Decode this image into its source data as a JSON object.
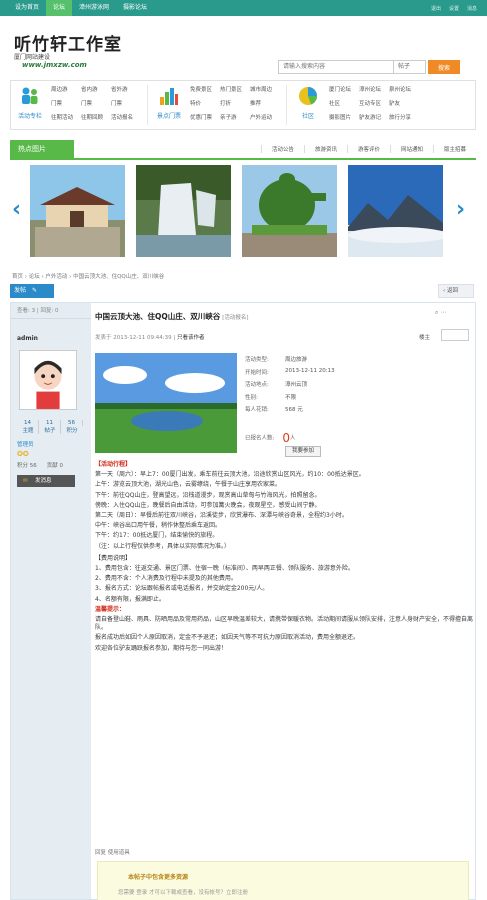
{
  "topbar": {
    "links": [
      "设为首页",
      "论坛",
      "漳州游泳网",
      "摄影论坛"
    ],
    "active_index": 1,
    "right": [
      "退出",
      "设置",
      "消息"
    ]
  },
  "header": {
    "logo_title": "听竹轩工作室",
    "logo_subtitle": "厦门网站建设",
    "logo_url": "www.jmxzw.com",
    "search_placeholder": "请输入搜索内容",
    "search_scope": "帖子",
    "search_button": "搜索"
  },
  "nav": {
    "groups": [
      {
        "icon": "people-icon",
        "label": "活动专栏",
        "color": "#2a9ad8",
        "links": [
          "周边游",
          "省内游",
          "省外游",
          "门票",
          "门票",
          "门票",
          "往期活动",
          "往期回顾",
          "活动报名"
        ]
      },
      {
        "icon": "bar-chart-icon",
        "label": "景点门票",
        "color": "#f0a020",
        "links": [
          "免费景区",
          "热门景区",
          "城市周边",
          "特价",
          "打折",
          "推荐",
          "优惠门票",
          "亲子游",
          "户外运动"
        ]
      },
      {
        "icon": "pie-chart-icon",
        "label": "社区",
        "color": "#e8c020",
        "links": [
          "厦门论坛",
          "漳州论坛",
          "泉州论坛",
          "社区",
          "互动专区",
          "驴友",
          "摄影图片",
          "驴友游记",
          "旅行分享"
        ]
      }
    ]
  },
  "hot": {
    "tab": "热点图片",
    "links": [
      "活动公告",
      "旅游资讯",
      "游客评价",
      "网站通知",
      "版主招募"
    ]
  },
  "gallery": {
    "photos": [
      "temple-photo",
      "waterfall-photo",
      "topiary-photo",
      "mountain-photo"
    ]
  },
  "breadcrumb": "首页 › 论坛 › 户外活动 › 中国云顶大池、住QQ山庄、双川峡谷",
  "actions": {
    "post_button": "发帖",
    "back_button": "返回"
  },
  "post": {
    "side_top": "查看: 3 | 回复: 0",
    "author": "admin",
    "stats": [
      {
        "n": "14",
        "l": "主题"
      },
      {
        "n": "11",
        "l": "帖子"
      },
      {
        "n": "56",
        "l": "积分"
      }
    ],
    "rank": "管理员",
    "points_a": "积分 56",
    "points_b": "贡献 0",
    "send_message": "发消息",
    "title": "中国云顶大池、住QQ山庄、双川峡谷",
    "category": "[活动报名]",
    "meta": "发表于 2013-12-11 09:44:39",
    "meta_link": "只看该作者",
    "floor_label": "楼主",
    "info": [
      {
        "k": "活动类型:",
        "v": "周边旅游"
      },
      {
        "k": "开始时间:",
        "v": "2013-12-11 20:13"
      },
      {
        "k": "活动地点:",
        "v": "漳州云顶"
      },
      {
        "k": "性别:",
        "v": "不限"
      },
      {
        "k": "每人花销:",
        "v": "568 元"
      }
    ],
    "joined_label": "已报名人数:",
    "joined_count": "0",
    "joined_unit": "人",
    "join_button": "我要参加",
    "section1": "【活动行程】",
    "paragraphs": [
      "第一天（周六）：早上7：00厦门出发，乘车前往云顶大池，沿途欣赏山区风光，约10：00抵达景区。",
      "上午：游览云顶大池，湖光山色，云雾缭绕，午餐于山庄享用农家菜。",
      "下午：前往QQ山庄，登高望远，沿栈道漫步，观赏高山草甸与竹海风光，拍照留念。",
      "傍晚：入住QQ山庄，晚餐后自由活动，可参加篝火晚会，夜观星空，感受山间宁静。",
      "第二天（周日）：早餐后前往双川峡谷，沿溪徒步，欣赏瀑布、深潭与峡谷奇景，全程约3小时。",
      "中午：峡谷出口用午餐，稍作休整后乘车返回。",
      "下午：约17：00抵达厦门，结束愉快的旅程。",
      "（注：以上行程仅供参考，具体以实际情况为准。）"
    ],
    "section2": "【费用说明】",
    "paragraphs2": [
      "1、费用包含：往返交通、景区门票、住宿一晚（标准间）、两早两正餐、领队服务、旅游意外险。",
      "2、费用不含：个人消费及行程中未提及的其他费用。",
      "3、报名方式：论坛跟帖报名或电话报名，并交纳定金200元/人。",
      "4、名额有限，报满即止。"
    ],
    "notice_title": "温馨提示：",
    "notice": "请自备登山鞋、雨具、防晒用品及常用药品，山区早晚温差较大，请携带保暖衣物。活动期间请服从领队安排，注意人身财产安全，不得擅自离队。",
    "notice2": "报名成功后如因个人原因取消，定金不予退还；如因天气等不可抗力原因取消活动，费用全额退还。",
    "closing": "欢迎各位驴友踊跃报名参加，期待与您一同出游！",
    "reply_label": "回复 使用道具",
    "closed_title": "本帖子中包含更多资源",
    "closed_body": "您需要 登录 才可以下载或查看，没有帐号？立即注册"
  }
}
